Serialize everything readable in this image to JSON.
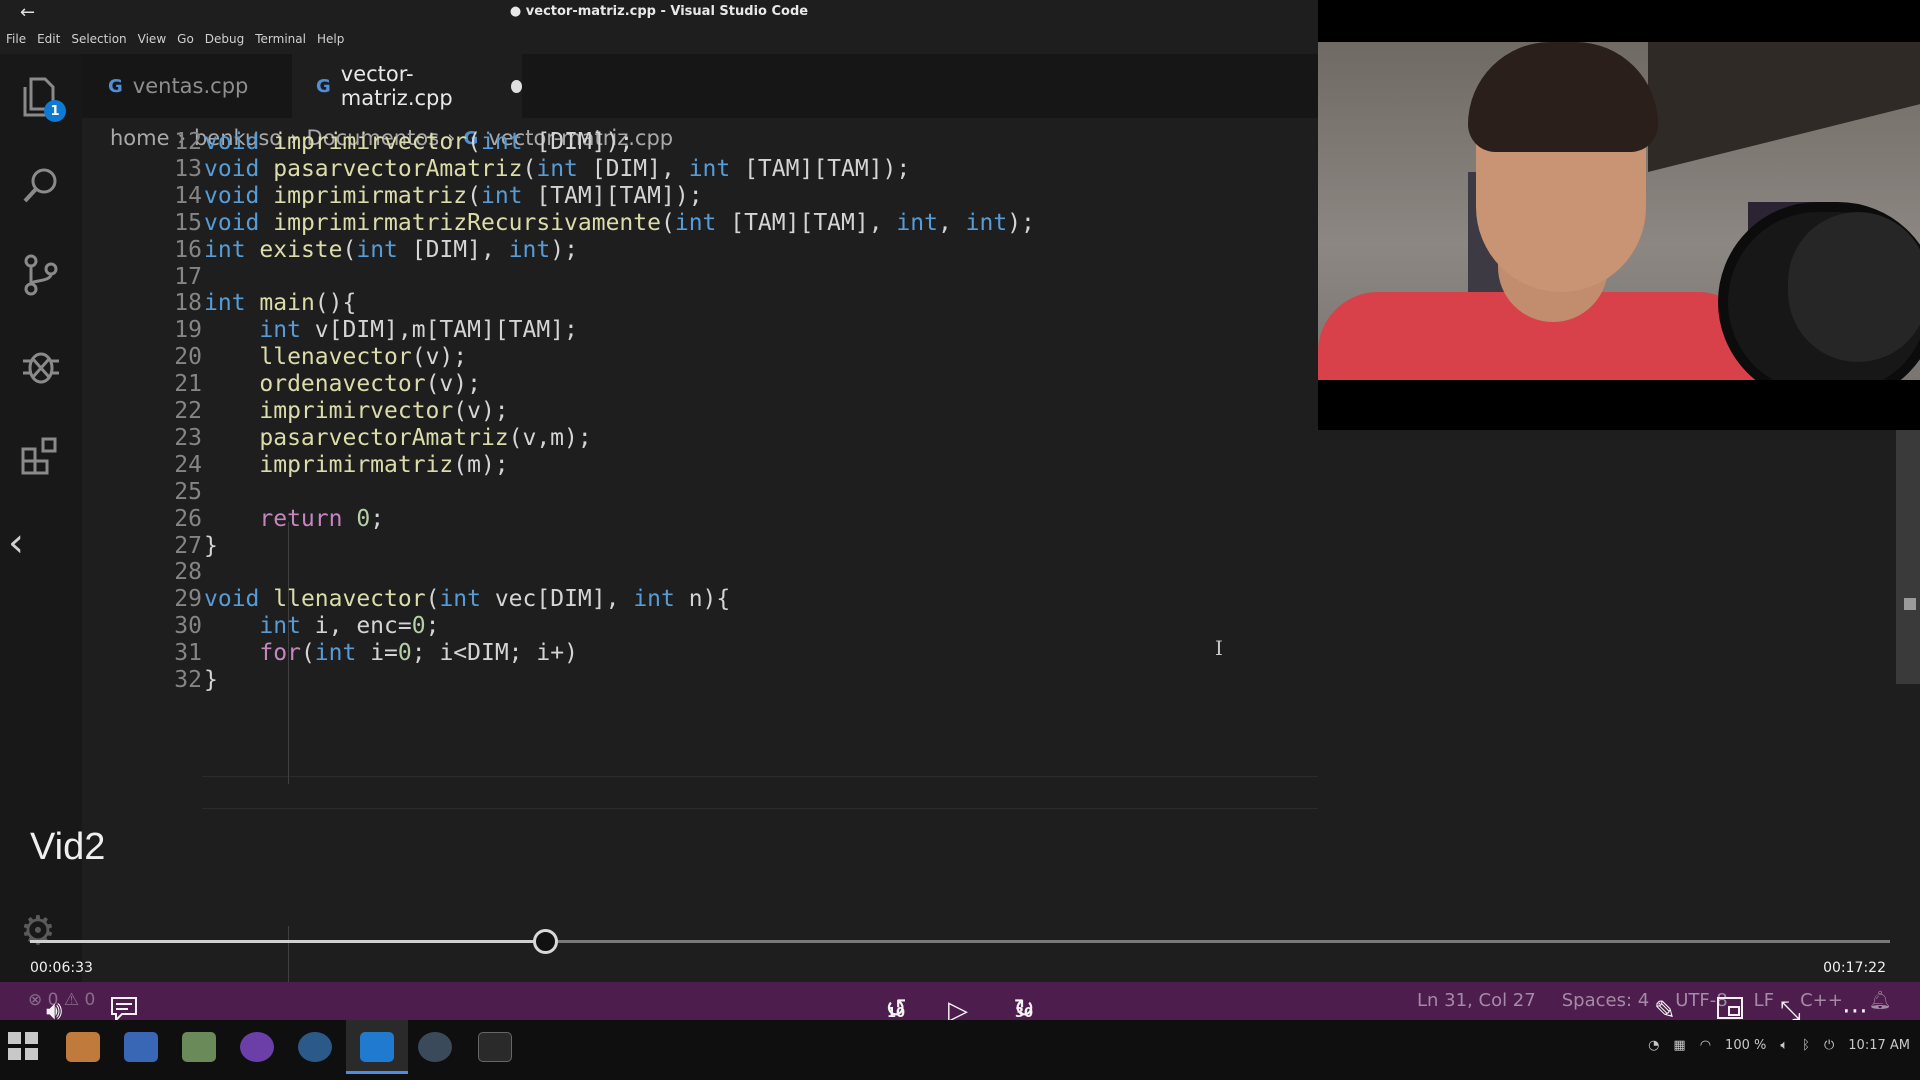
{
  "window": {
    "title": "● vector-matriz.cpp - Visual Studio Code"
  },
  "menu": [
    "File",
    "Edit",
    "Selection",
    "View",
    "Go",
    "Debug",
    "Terminal",
    "Help"
  ],
  "activity": {
    "explorer_badge": "1"
  },
  "tabs": [
    {
      "icon": "G",
      "label": "ventas.cpp"
    },
    {
      "icon": "G",
      "label": "vector-matriz.cpp"
    }
  ],
  "breadcrumb": [
    "home",
    "benkuso",
    "Documentos",
    "vector-matriz.cpp"
  ],
  "code": [
    {
      "n": "12",
      "t": "void imprimirvector(int [DIM]);"
    },
    {
      "n": "13",
      "t": "void pasarvectorAmatriz(int [DIM], int [TAM][TAM]);"
    },
    {
      "n": "14",
      "t": "void imprimirmatriz(int [TAM][TAM]);"
    },
    {
      "n": "15",
      "t": "void imprimirmatrizRecursivamente(int [TAM][TAM], int, int);"
    },
    {
      "n": "16",
      "t": "int existe(int [DIM], int);"
    },
    {
      "n": "17",
      "t": ""
    },
    {
      "n": "18",
      "t": "int main(){"
    },
    {
      "n": "19",
      "t": "    int v[DIM],m[TAM][TAM];"
    },
    {
      "n": "20",
      "t": "    llenavector(v);"
    },
    {
      "n": "21",
      "t": "    ordenavector(v);"
    },
    {
      "n": "22",
      "t": "    imprimirvector(v);"
    },
    {
      "n": "23",
      "t": "    pasarvectorAmatriz(v,m);"
    },
    {
      "n": "24",
      "t": "    imprimirmatriz(m);"
    },
    {
      "n": "25",
      "t": ""
    },
    {
      "n": "26",
      "t": "    return 0;"
    },
    {
      "n": "27",
      "t": "}"
    },
    {
      "n": "28",
      "t": ""
    },
    {
      "n": "29",
      "t": "void llenavector(int vec[DIM], int n){"
    },
    {
      "n": "30",
      "t": "    int i, enc=0;"
    },
    {
      "n": "31",
      "t": "    for(int i=0; i<DIM; i+)"
    },
    {
      "n": "32",
      "t": "}"
    }
  ],
  "player": {
    "title": "Vid2",
    "elapsed": "00:06:33",
    "duration": "00:17:22",
    "progress_fraction": 0.277,
    "skip_back": "10",
    "skip_forward": "30"
  },
  "status": {
    "problems": "⊗ 0 ⚠ 0",
    "position": "Ln 31, Col 27",
    "spaces": "Spaces: 4",
    "encoding": "UTF-8",
    "eol": "LF",
    "language": "C++"
  },
  "tray": {
    "battery": "100 %",
    "clock": "10:17 AM"
  }
}
